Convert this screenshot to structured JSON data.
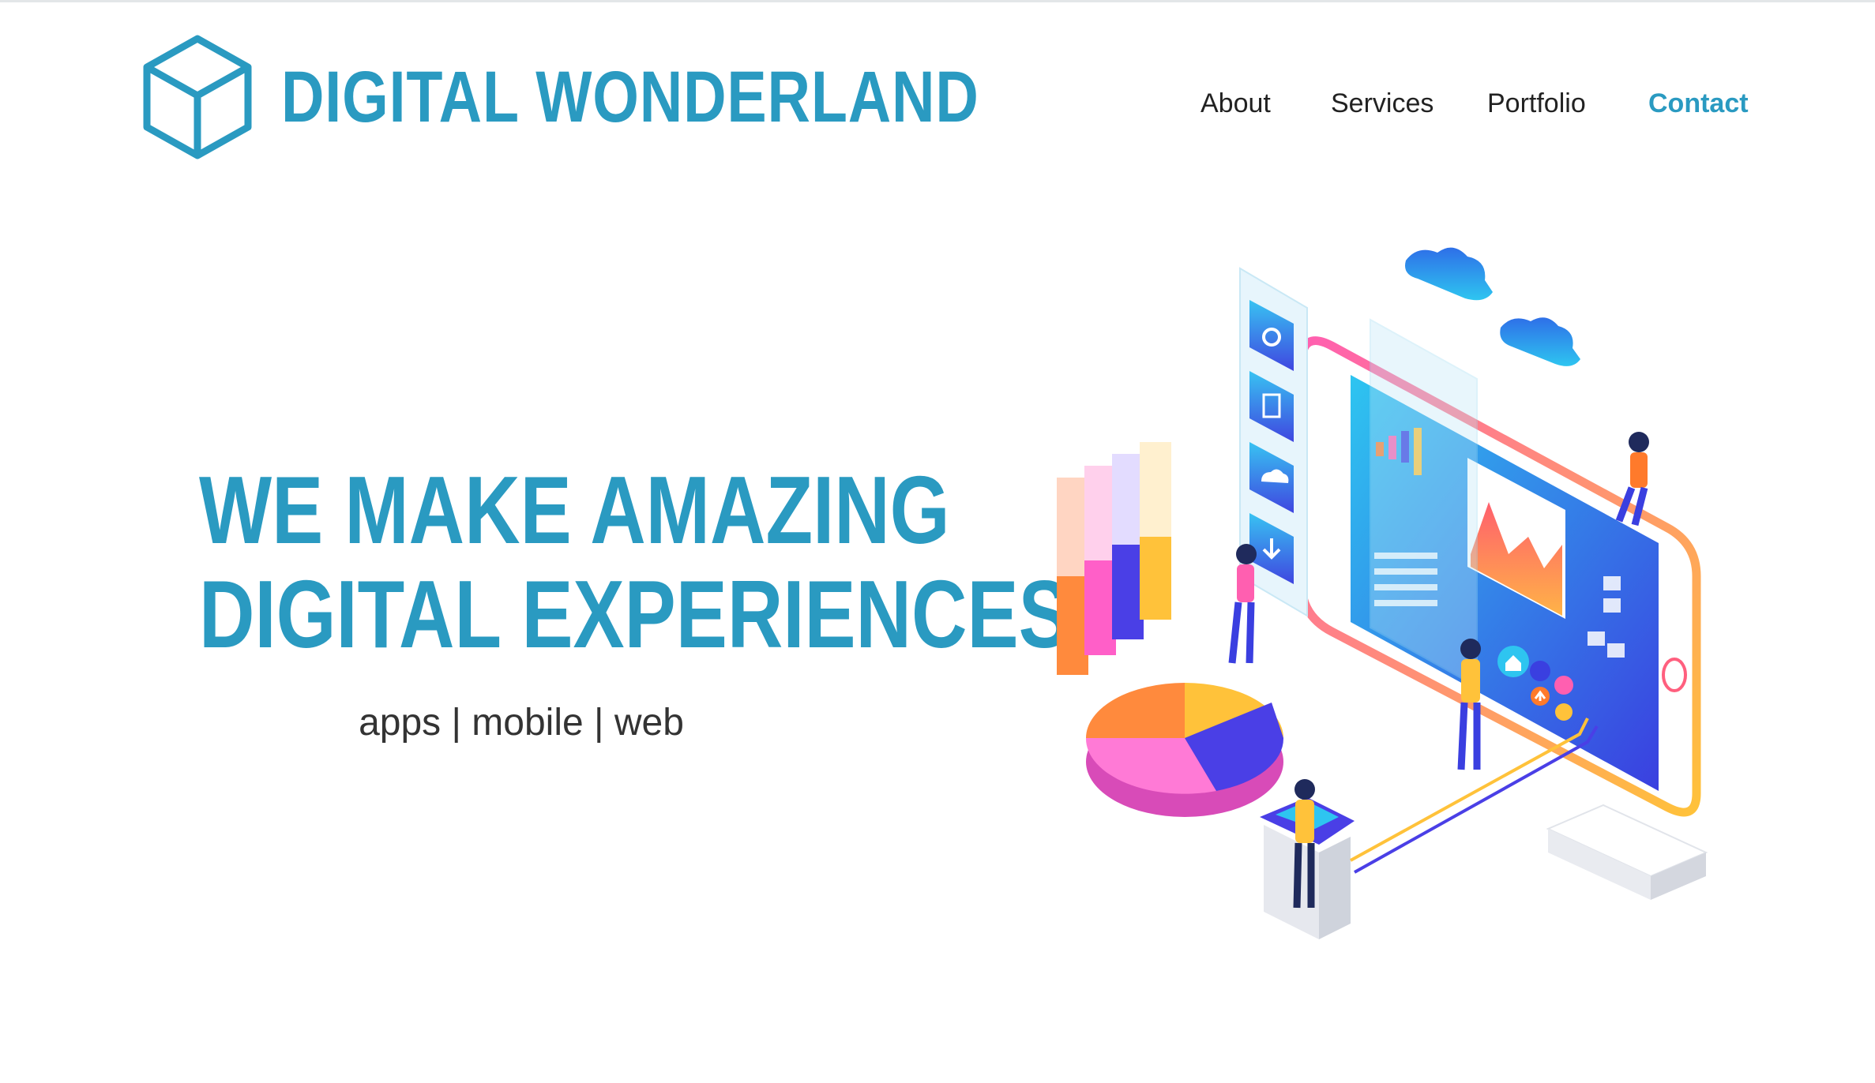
{
  "brand": {
    "name": "DIGITAL WONDERLAND",
    "icon": "cube-icon",
    "color": "#2a9ac1"
  },
  "nav": {
    "items": [
      {
        "label": "About"
      },
      {
        "label": "Services"
      },
      {
        "label": "Portfolio"
      },
      {
        "label": "Contact",
        "active": true
      }
    ]
  },
  "hero": {
    "title_line1": "WE MAKE AMAZING",
    "title_line2": "DIGITAL EXPERIENCES",
    "subtitle": "apps | mobile | web"
  },
  "illustration": {
    "icons": [
      "gear-icon",
      "document-icon",
      "cloud-icon",
      "download-icon",
      "home-icon",
      "arrow-up-icon"
    ]
  },
  "colors": {
    "accent": "#2a9ac1",
    "text": "#333333",
    "nav_text": "#222222"
  }
}
